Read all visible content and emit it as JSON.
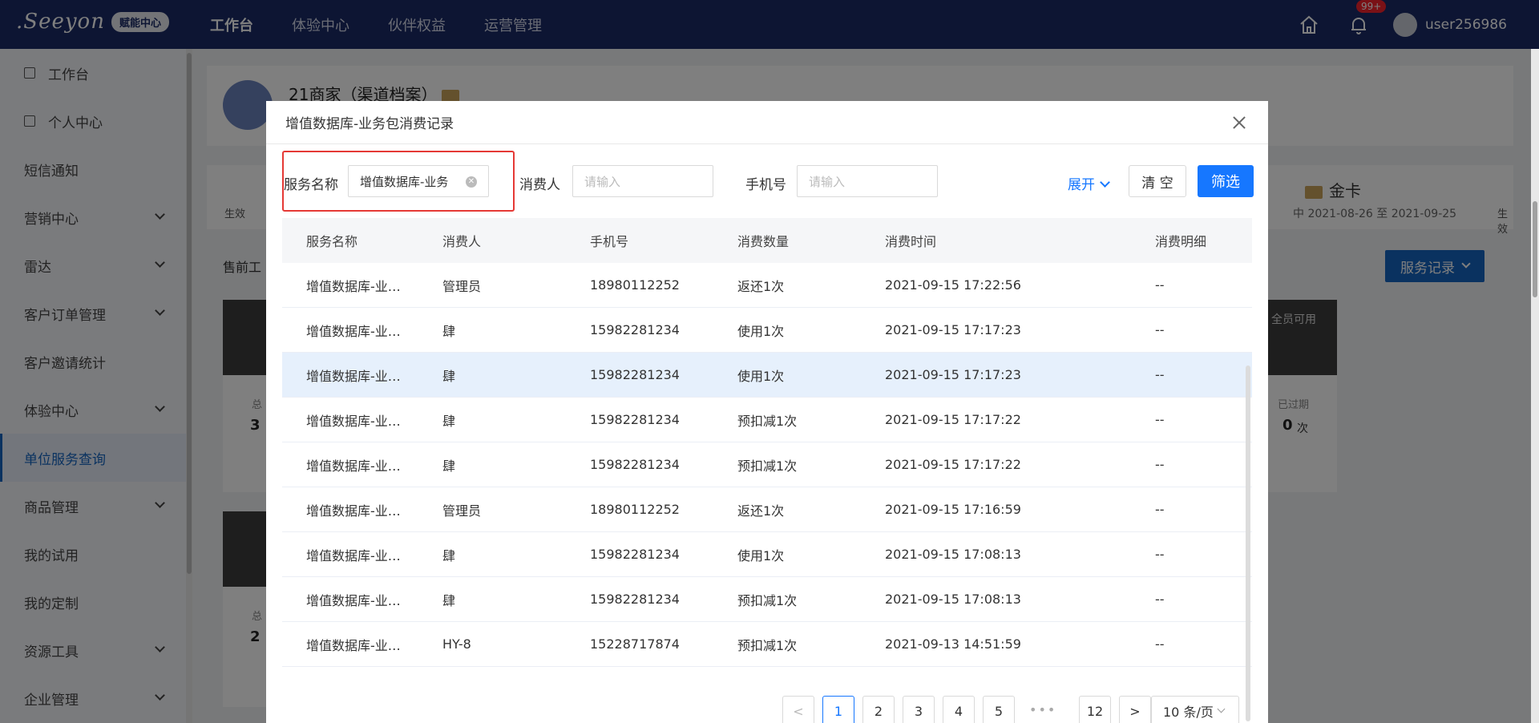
{
  "topbar": {
    "logo": ".Seeyon",
    "logo_badge": "赋能中心",
    "nav": [
      "工作台",
      "体验中心",
      "伙伴权益",
      "运营管理"
    ],
    "notification_count": "99+",
    "username": "user256986"
  },
  "sidebar": {
    "items": [
      {
        "label": "工作台"
      },
      {
        "label": "个人中心"
      },
      {
        "label": "短信通知"
      },
      {
        "label": "营销中心"
      },
      {
        "label": "雷达"
      },
      {
        "label": "客户订单管理"
      },
      {
        "label": "客户邀请统计"
      },
      {
        "label": "体验中心"
      },
      {
        "label": "单位服务查询"
      },
      {
        "label": "商品管理"
      },
      {
        "label": "我的试用"
      },
      {
        "label": "我的定制"
      },
      {
        "label": "资源工具"
      },
      {
        "label": "企业管理"
      }
    ]
  },
  "background": {
    "shop_name": "21商家（渠道档案）",
    "gold_card": "金卡",
    "gold_card_date": "中  2021-08-26 至 2021-09-25",
    "presale": "售前工",
    "service_record_button": "服务记录",
    "all_staff": "全员可用",
    "expired_label": "已过期",
    "expired_value": "0",
    "expired_unit": "次",
    "left_label_1": "总",
    "left_value_1": "3",
    "left_label_2": "总",
    "left_value_2": "2",
    "status_1": "生效",
    "status_2": "生效"
  },
  "modal": {
    "title": "增值数据库-业务包消费记录",
    "filters": {
      "service_label": "服务名称",
      "service_value": "增值数据库-业务",
      "consumer_label": "消费人",
      "consumer_placeholder": "请输入",
      "phone_label": "手机号",
      "phone_placeholder": "请输入",
      "expand": "展开",
      "clear": "清 空",
      "filter": "筛选"
    },
    "table": {
      "headers": [
        "服务名称",
        "消费人",
        "手机号",
        "消费数量",
        "消费时间",
        "消费明细"
      ],
      "rows": [
        [
          "增值数据库-业…",
          "管理员",
          "18980112252",
          "返还1次",
          "2021-09-15 17:22:56",
          "--"
        ],
        [
          "增值数据库-业…",
          "肆",
          "15982281234",
          "使用1次",
          "2021-09-15 17:17:23",
          "--"
        ],
        [
          "增值数据库-业…",
          "肆",
          "15982281234",
          "使用1次",
          "2021-09-15 17:17:23",
          "--"
        ],
        [
          "增值数据库-业…",
          "肆",
          "15982281234",
          "预扣减1次",
          "2021-09-15 17:17:22",
          "--"
        ],
        [
          "增值数据库-业…",
          "肆",
          "15982281234",
          "预扣减1次",
          "2021-09-15 17:17:22",
          "--"
        ],
        [
          "增值数据库-业…",
          "管理员",
          "18980112252",
          "返还1次",
          "2021-09-15 17:16:59",
          "--"
        ],
        [
          "增值数据库-业…",
          "肆",
          "15982281234",
          "使用1次",
          "2021-09-15 17:08:13",
          "--"
        ],
        [
          "增值数据库-业…",
          "肆",
          "15982281234",
          "预扣减1次",
          "2021-09-15 17:08:13",
          "--"
        ],
        [
          "增值数据库-业…",
          "HY-8",
          "15228717874",
          "预扣减1次",
          "2021-09-13 14:51:59",
          "--"
        ]
      ]
    },
    "pager": {
      "pages": [
        "1",
        "2",
        "3",
        "4",
        "5"
      ],
      "last": "12",
      "dots": "•••",
      "prev": "<",
      "next": ">",
      "page_size": "10 条/页"
    }
  }
}
